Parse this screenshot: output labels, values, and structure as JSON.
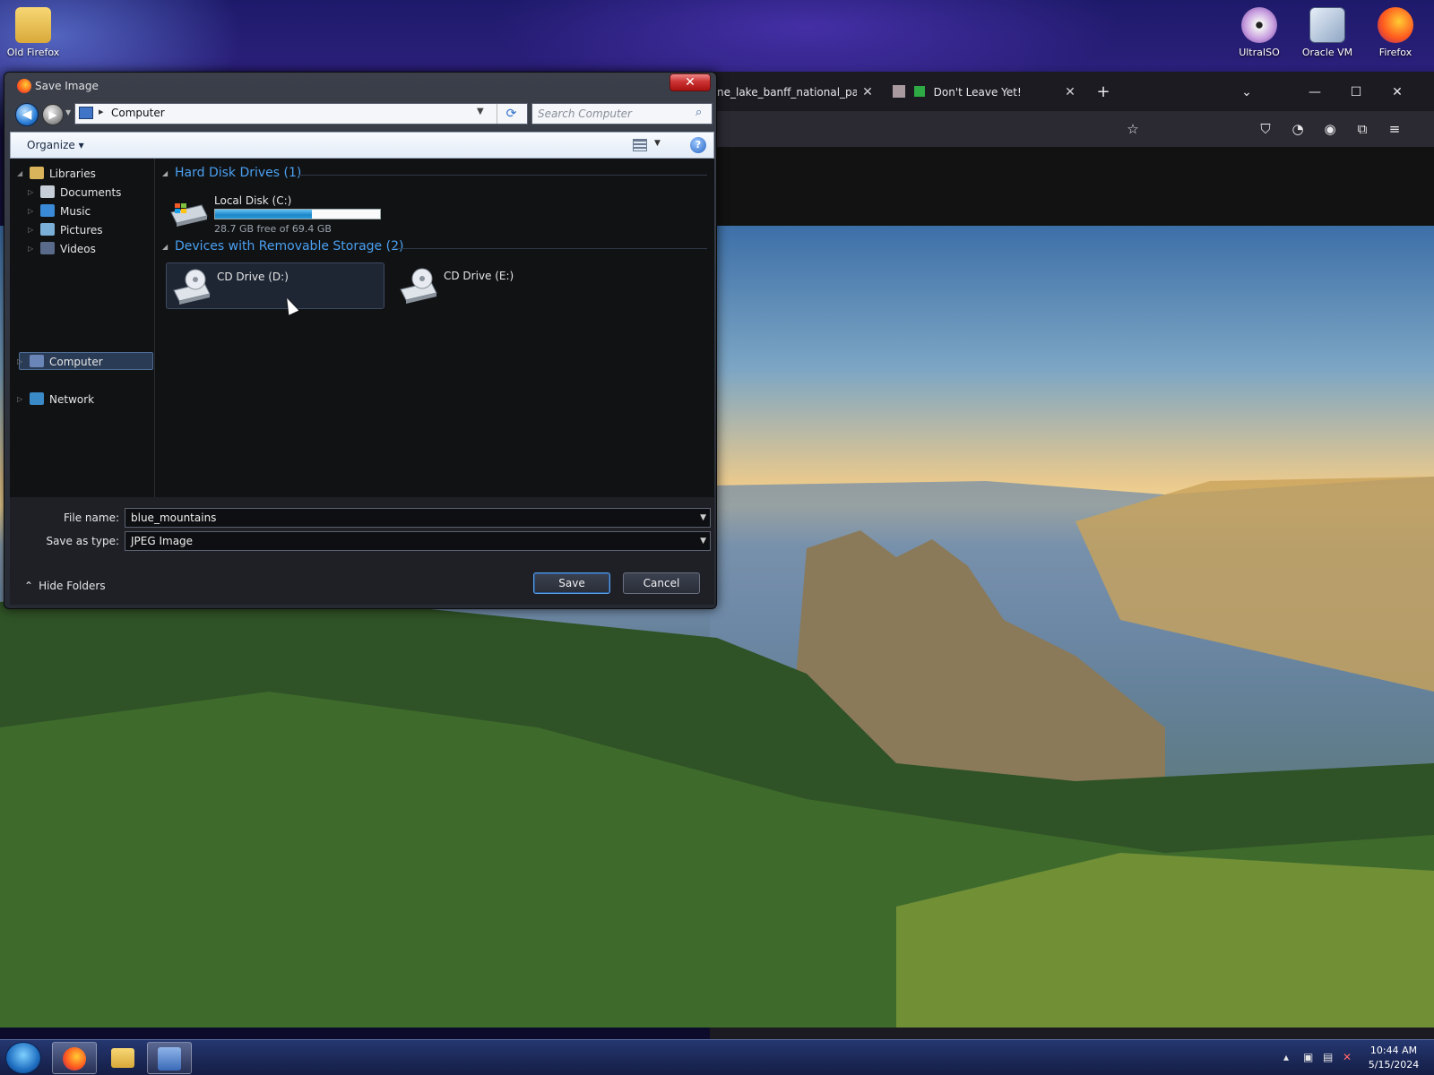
{
  "desktop": {
    "icons": [
      {
        "label": "Old Firefox"
      },
      {
        "label": "UltraISO"
      },
      {
        "label": "Oracle VM"
      },
      {
        "label": "Firefox"
      }
    ]
  },
  "browser": {
    "tabs": [
      {
        "label": "ne_lake_banff_national_park.j"
      },
      {
        "label": "Don't Leave Yet!"
      }
    ],
    "new_tab_label": "+",
    "tab_list_label": "⌄",
    "close_glyph": "✕",
    "minimize_glyph": "—",
    "maximize_glyph": "☐"
  },
  "dialog": {
    "title": "Save Image",
    "close_glyph": "✕",
    "address": {
      "location": "Computer"
    },
    "search": {
      "placeholder": "Search Computer"
    },
    "toolbar": {
      "organize_label": "Organize ▾",
      "help_glyph": "?"
    },
    "nav_tree": [
      {
        "label": "Libraries"
      },
      {
        "label": "Documents"
      },
      {
        "label": "Music"
      },
      {
        "label": "Pictures"
      },
      {
        "label": "Videos"
      },
      {
        "label": "Computer"
      },
      {
        "label": "Network"
      }
    ],
    "groups": [
      {
        "header": "Hard Disk Drives (1)"
      },
      {
        "header": "Devices with Removable Storage (2)"
      }
    ],
    "drives": [
      {
        "name": "Local Disk (C:)",
        "free_text": "28.7 GB free of 69.4 GB",
        "used_fraction": 0.586
      },
      {
        "name": "CD Drive (D:)"
      },
      {
        "name": "CD Drive (E:)"
      }
    ],
    "file_name": {
      "label": "File name:",
      "value": "blue_mountains"
    },
    "save_type": {
      "label": "Save as type:",
      "value": "JPEG Image"
    },
    "hide_folders_label": "Hide Folders",
    "save_label": "Save",
    "cancel_label": "Cancel"
  },
  "taskbar": {
    "time": "10:44 AM",
    "date": "5/15/2024"
  },
  "colors": {
    "accent": "#4aa0f0",
    "usage_fill": "#1d86c8"
  }
}
